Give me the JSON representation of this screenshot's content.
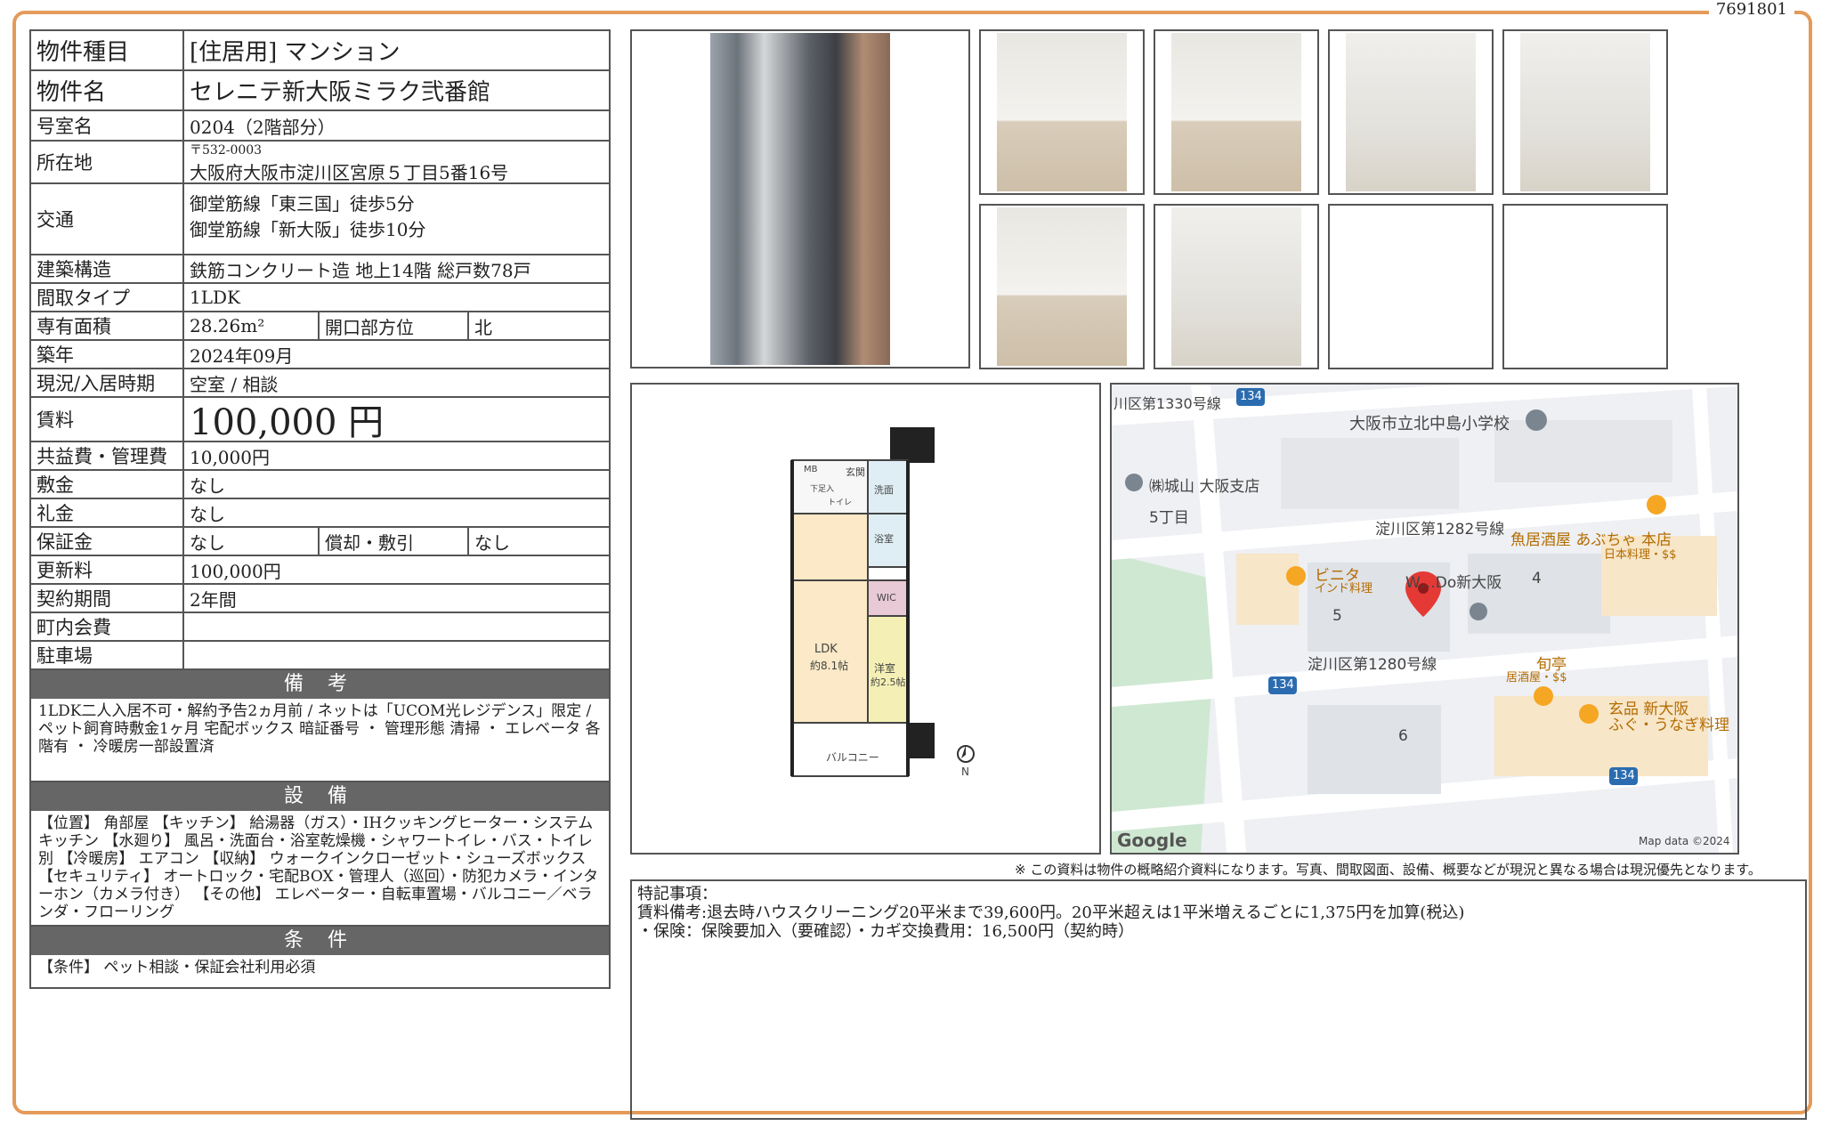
{
  "doc_id": "7691801",
  "property": {
    "type_label": "物件種目",
    "type_value": "[住居用] マンション",
    "name_label": "物件名",
    "name_value": "セレニテ新大阪ミラク弐番館",
    "room_label": "号室名",
    "room_value": "0204（2階部分）",
    "address_label": "所在地",
    "postal": "〒532-0003",
    "address": "大阪府大阪市淀川区宮原５丁目5番16号",
    "access_label": "交通",
    "access_1": "御堂筋線「東三国」徒歩5分",
    "access_2": "御堂筋線「新大阪」徒歩10分",
    "structure_label": "建築構造",
    "structure_value": "鉄筋コンクリート造 地上14階 総戸数78戸",
    "layout_label": "間取タイプ",
    "layout_value": "1LDK",
    "area_label": "専有面積",
    "area_value": "28.26m²",
    "direction_label": "開口部方位",
    "direction_value": "北",
    "built_label": "築年",
    "built_value": "2024年09月",
    "status_label": "現況/入居時期",
    "status_value": "空室 / 相談",
    "rent_label": "賃料",
    "rent_value": "100,000 円",
    "fee_label": "共益費・管理費",
    "fee_value": "10,000円",
    "deposit_label": "敷金",
    "deposit_value": "なし",
    "keymoney_label": "礼金",
    "keymoney_value": "なし",
    "guarantee_label": "保証金",
    "guarantee_value": "なし",
    "amort_label": "償却・敷引",
    "amort_value": "なし",
    "renewal_label": "更新料",
    "renewal_value": "100,000円",
    "contract_label": "契約期間",
    "contract_value": "2年間",
    "community_label": "町内会費",
    "community_value": "",
    "parking_label": "駐車場",
    "parking_value": ""
  },
  "remarks_section": {
    "title": "備 考",
    "text": "1LDK二人入居不可・解約予告2ヵ月前 / ネットは「UCOM光レジデンス」限定 / ペット飼育時敷金1ヶ月 宅配ボックス 暗証番号 ・ 管理形態 清掃 ・ エレベータ 各階有 ・ 冷暖房一部設置済"
  },
  "equipment_section": {
    "title": "設 備",
    "text": "【位置】 角部屋 【キッチン】 給湯器（ガス）・IHクッキングヒーター・システムキッチン 【水廻り】 風呂・洗面台・浴室乾燥機・シャワートイレ・バス・トイレ別 【冷暖房】 エアコン 【収納】 ウォークインクローゼット・シューズボックス 【セキュリティ】 オートロック・宅配BOX・管理人（巡回）・防犯カメラ・インターホン（カメラ付き） 【その他】 エレベーター・自転車置場・バルコニー／ベランダ・フローリング"
  },
  "conditions_section": {
    "title": "条 件",
    "text": "【条件】 ペット相談・保証会社利用必須"
  },
  "floorplan": {
    "mb": "MB",
    "genkan": "玄関",
    "shoes": "下足入",
    "toilet": "トイレ",
    "wash": "洗面",
    "bath": "浴室",
    "wic": "WIC",
    "ldk": "LDK",
    "ldk_size": "約8.1帖",
    "western": "洋室",
    "western_size": "約2.5帖",
    "balcony": "バルコニー",
    "north": "N"
  },
  "map": {
    "road_1330": "川区第1330号線",
    "route_134": "134",
    "school": "大阪市立北中島小学校",
    "shiroyama": "㈱城山 大阪支店",
    "block_5chome": "5丁目",
    "road_1282": "淀川区第1282号線",
    "izakaya": "魚居酒屋 あぶちゃ 本店",
    "izakaya_sub": "日本料理・$$",
    "vinita": "ビニタ",
    "vinita_sub": "インド料理",
    "shin_osaka_label": "W…Do新大阪",
    "block_4": "4",
    "block_5": "5",
    "block_6": "6",
    "road_1280": "淀川区第1280号線",
    "shuntei": "旬亭",
    "shuntei_sub": "居酒屋・$$",
    "genpin": "玄品 新大阪",
    "genpin_sub": "ふぐ・うなぎ料理",
    "google": "Google",
    "mapdata": "Map data ©2024"
  },
  "disclaimer": "※ この資料は物件の概略紹介資料になります。写真、間取図面、設備、概要などが現況と異なる場合は現況優先となります。",
  "special_notes": {
    "title": "特記事項：",
    "line1": "賃料備考:退去時ハウスクリーニング20平米まで39,600円。20平米超えは1平米増えるごとに1,375円を加算(税込)",
    "line2": "・保険：保険要加入（要確認）・カギ交換費用：16,500円（契約時）"
  },
  "colors": {
    "frame": "#e59a5a",
    "section_bar": "#666666",
    "map_pin": "#e53935",
    "poi": "#f5a623"
  }
}
